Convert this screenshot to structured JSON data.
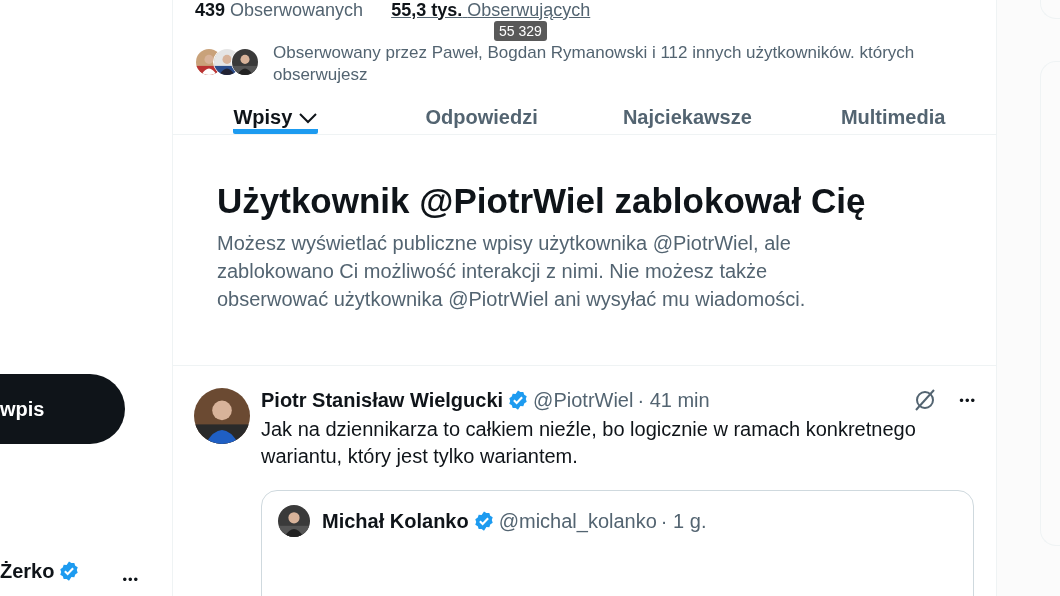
{
  "sidebar": {
    "post_button": "wpis",
    "account": {
      "name": "Żerko",
      "verified": true,
      "more": "•••"
    }
  },
  "profile": {
    "stats": [
      {
        "count": "439",
        "label": "Obserwowanych",
        "underlined": false
      },
      {
        "count": "55,3 tys.",
        "label": "Obserwujących",
        "underlined": true
      }
    ],
    "tooltip": "55 329",
    "followed_by": {
      "text": "Obserwowany przez Paweł, Bogdan Rymanowski i 112 innych użytkowników. których obserwujesz"
    }
  },
  "tabs": [
    {
      "label": "Wpisy",
      "selected": true,
      "dropdown": true
    },
    {
      "label": "Odpowiedzi",
      "selected": false,
      "dropdown": false
    },
    {
      "label": "Najciekawsze",
      "selected": false,
      "dropdown": false
    },
    {
      "label": "Multimedia",
      "selected": false,
      "dropdown": false
    }
  ],
  "blocked": {
    "title": "Użytkownik @PiotrWiel zablokował Cię",
    "text": "Możesz wyświetlać publiczne wpisy użytkownika @PiotrWiel, ale zablokowano Ci możliwość interakcji z nimi. Nie możesz także obserwować użytkownika @PiotrWiel ani wysyłać mu wiadomości."
  },
  "post": {
    "name": "Piotr Stanisław Wielgucki",
    "verified": true,
    "handle": "@PiotrWiel",
    "time": "· 41 min",
    "more": "•••",
    "text": "Jak na dziennikarza to całkiem nieźle, bo logicznie w ramach konkretnego wariantu, który jest tylko wariantem.",
    "quote": {
      "name": "Michał Kolanko",
      "verified": true,
      "handle": "@michal_kolanko",
      "time": "· 1 g."
    }
  }
}
